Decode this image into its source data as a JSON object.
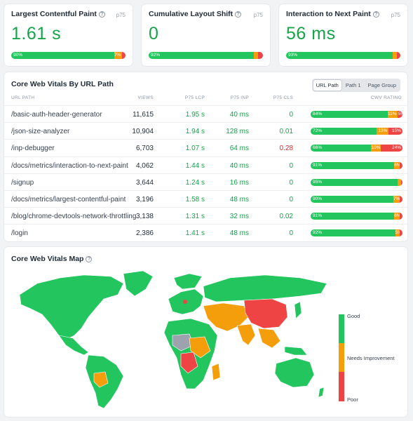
{
  "metrics": [
    {
      "title": "Largest Contentful Paint",
      "p75": "p75",
      "value": "1.61 s",
      "good": 90,
      "ni": 7,
      "poor": 3,
      "good_label": "90%",
      "ni_label": "7%",
      "poor_label": ""
    },
    {
      "title": "Cumulative Layout Shift",
      "p75": "p75",
      "value": "0",
      "good": 92,
      "ni": 4,
      "poor": 4,
      "good_label": "92%",
      "ni_label": "",
      "poor_label": ""
    },
    {
      "title": "Interaction to Next Paint",
      "p75": "p75",
      "value": "56 ms",
      "good": 93,
      "ni": 4,
      "poor": 3,
      "good_label": "93%",
      "ni_label": "",
      "poor_label": ""
    }
  ],
  "table": {
    "title": "Core Web Vitals By URL Path",
    "toggle": [
      "URL Path",
      "Path 1",
      "Page Group"
    ],
    "headers": {
      "path": "URL PATH",
      "views": "VIEWS",
      "lcp": "P75 LCP",
      "inp": "P75 INP",
      "cls": "P75 CLS",
      "rating": "CWV RATING"
    },
    "rows": [
      {
        "path": "/basic-auth-header-generator",
        "views": "11,615",
        "lcp": "1.95 s",
        "inp": "40 ms",
        "cls": "0",
        "cls_bad": false,
        "good": 84,
        "ni": 11,
        "poor": 5,
        "good_label": "84%",
        "ni_label": "11%",
        "poor_label": "5%"
      },
      {
        "path": "/json-size-analyzer",
        "views": "10,904",
        "lcp": "1.94 s",
        "inp": "128 ms",
        "cls": "0.01",
        "cls_bad": false,
        "good": 72,
        "ni": 13,
        "poor": 15,
        "good_label": "72%",
        "ni_label": "13%",
        "poor_label": "15%"
      },
      {
        "path": "/inp-debugger",
        "views": "6,703",
        "lcp": "1.07 s",
        "inp": "64 ms",
        "cls": "0.28",
        "cls_bad": true,
        "good": 66,
        "ni": 10,
        "poor": 24,
        "good_label": "66%",
        "ni_label": "10%",
        "poor_label": "24%"
      },
      {
        "path": "/docs/metrics/interaction-to-next-paint",
        "views": "4,062",
        "lcp": "1.44 s",
        "inp": "40 ms",
        "cls": "0",
        "cls_bad": false,
        "good": 91,
        "ni": 6,
        "poor": 3,
        "good_label": "91%",
        "ni_label": "6%",
        "poor_label": ""
      },
      {
        "path": "/signup",
        "views": "3,644",
        "lcp": "1.24 s",
        "inp": "16 ms",
        "cls": "0",
        "cls_bad": false,
        "good": 95,
        "ni": 4,
        "poor": 1,
        "good_label": "95%",
        "ni_label": "",
        "poor_label": ""
      },
      {
        "path": "/docs/metrics/largest-contentful-paint",
        "views": "3,196",
        "lcp": "1.58 s",
        "inp": "48 ms",
        "cls": "0",
        "cls_bad": false,
        "good": 90,
        "ni": 7,
        "poor": 3,
        "good_label": "90%",
        "ni_label": "7%",
        "poor_label": ""
      },
      {
        "path": "/blog/chrome-devtools-network-throttling",
        "views": "3,138",
        "lcp": "1.31 s",
        "inp": "32 ms",
        "cls": "0.02",
        "cls_bad": false,
        "good": 91,
        "ni": 6,
        "poor": 3,
        "good_label": "91%",
        "ni_label": "6%",
        "poor_label": ""
      },
      {
        "path": "/login",
        "views": "2,386",
        "lcp": "1.41 s",
        "inp": "48 ms",
        "cls": "0",
        "cls_bad": false,
        "good": 92,
        "ni": 5,
        "poor": 3,
        "good_label": "92%",
        "ni_label": "5%",
        "poor_label": ""
      }
    ]
  },
  "map": {
    "title": "Core Web Vitals Map",
    "legend": {
      "good": "Good",
      "ni": "Needs Improvement",
      "poor": "Poor"
    }
  },
  "colors": {
    "good": "#22c55e",
    "ni": "#f59e0b",
    "poor": "#ef4444",
    "no_data": "#9ca3af"
  },
  "icons": {
    "help": "help-circle-icon"
  }
}
